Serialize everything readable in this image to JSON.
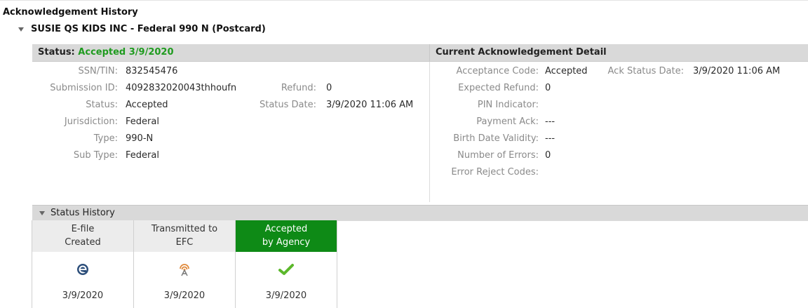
{
  "page": {
    "title": "Acknowledgement History",
    "group_title": "SUSIE QS KIDS INC - Federal 990 N (Postcard)"
  },
  "status_panel": {
    "label": "Status:",
    "value": "Accepted 3/9/2020",
    "status_color": "#1f9b1f",
    "fields": {
      "ssn_tin_label": "SSN/TIN:",
      "ssn_tin": "832545476",
      "submission_id_label": "Submission ID:",
      "submission_id": "4092832020043thhoufn",
      "refund_label": "Refund:",
      "refund": "0",
      "status_label": "Status:",
      "status": "Accepted",
      "status_date_label": "Status Date:",
      "status_date": "3/9/2020 11:06 AM",
      "jurisdiction_label": "Jurisdiction:",
      "jurisdiction": "Federal",
      "type_label": "Type:",
      "type": "990-N",
      "sub_type_label": "Sub Type:",
      "sub_type": "Federal"
    }
  },
  "ack_detail": {
    "title": "Current Acknowledgement Detail",
    "acceptance_code_label": "Acceptance Code:",
    "acceptance_code": "Accepted",
    "ack_status_date_label": "Ack Status Date:",
    "ack_status_date": "3/9/2020 11:06 AM",
    "expected_refund_label": "Expected Refund:",
    "expected_refund": "0",
    "pin_indicator_label": "PIN Indicator:",
    "pin_indicator": "",
    "payment_ack_label": "Payment Ack:",
    "payment_ack": "---",
    "birth_date_validity_label": "Birth Date Validity:",
    "birth_date_validity": "---",
    "number_of_errors_label": "Number of Errors:",
    "number_of_errors": "0",
    "error_reject_codes_label": "Error Reject Codes:",
    "error_reject_codes": ""
  },
  "status_history": {
    "title": "Status History",
    "steps": [
      {
        "label_line1": "E-file",
        "label_line2": "Created",
        "icon": "efile-e-icon",
        "date": "3/9/2020"
      },
      {
        "label_line1": "Transmitted to",
        "label_line2": "EFC",
        "icon": "transmit-antenna-icon",
        "date": "3/9/2020"
      },
      {
        "label_line1": "Accepted",
        "label_line2": "by Agency",
        "icon": "checkmark-icon",
        "date": "3/9/2020"
      }
    ],
    "active_color": "#0e8a16"
  }
}
